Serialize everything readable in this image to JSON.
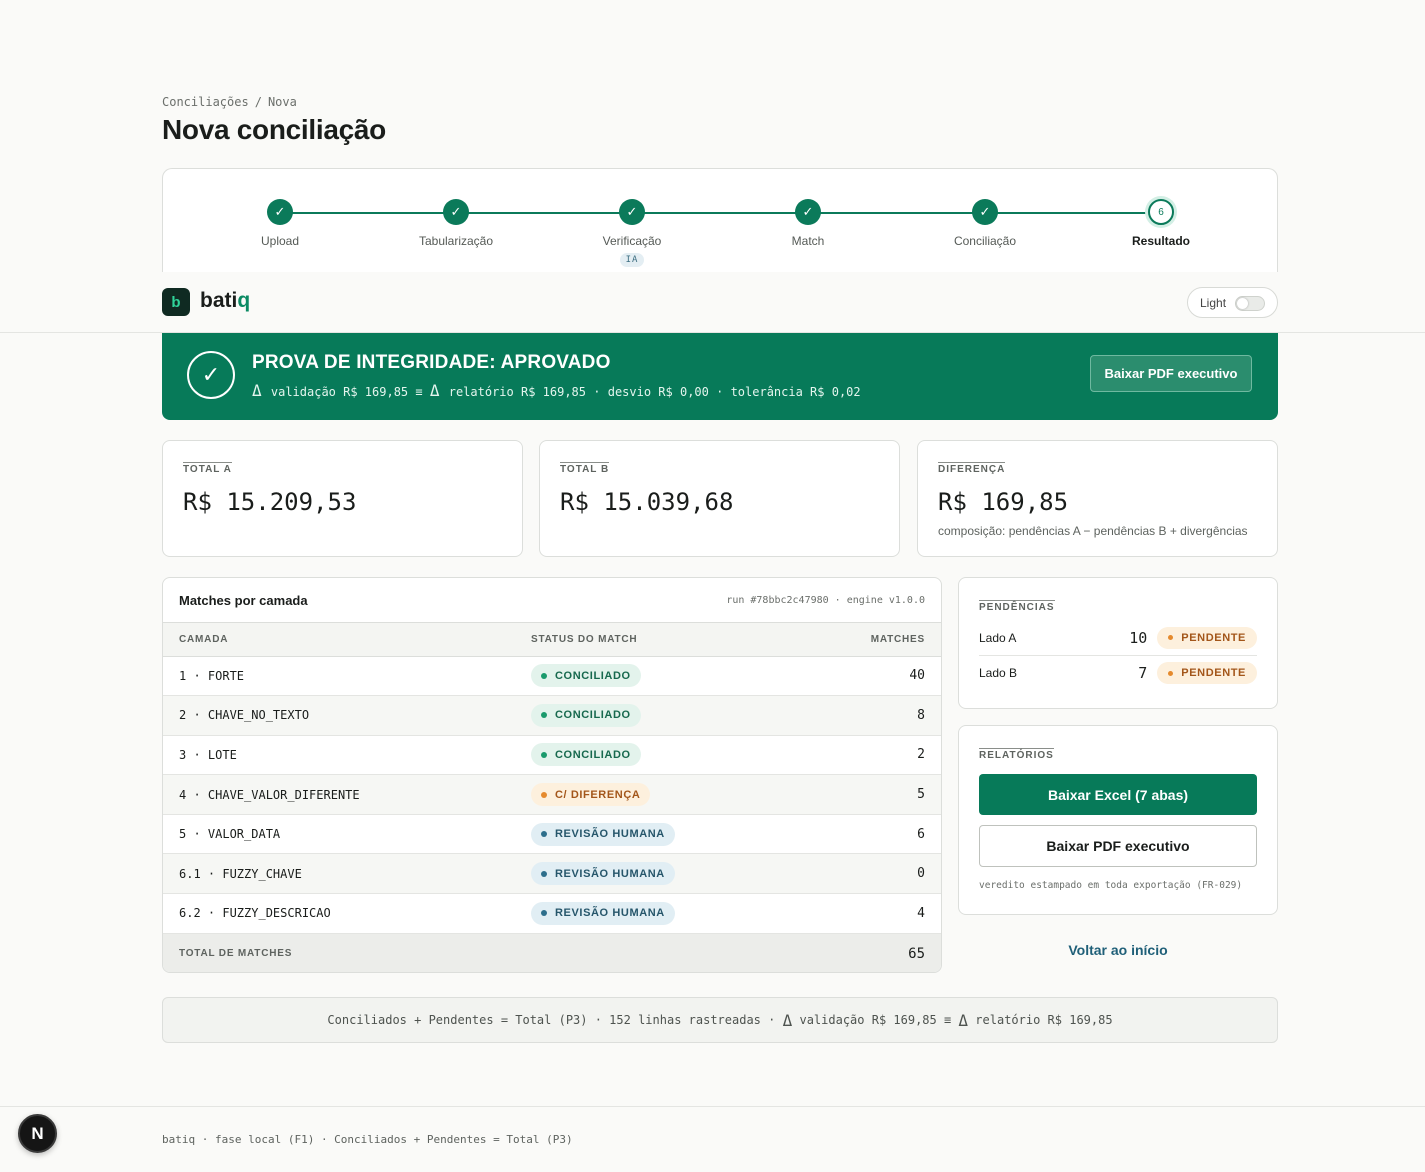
{
  "breadcrumb": {
    "parent": "Conciliações",
    "separator": "/",
    "current": "Nova"
  },
  "page_title": "Nova conciliação",
  "stepper": {
    "steps": [
      {
        "label": "Upload",
        "state": "done"
      },
      {
        "label": "Tabularização",
        "state": "done"
      },
      {
        "label": "Verificação",
        "state": "done",
        "badge": "IA"
      },
      {
        "label": "Match",
        "state": "done"
      },
      {
        "label": "Conciliação",
        "state": "done"
      },
      {
        "label": "Resultado",
        "state": "current",
        "number": "6"
      }
    ]
  },
  "navbar": {
    "logo_letter": "b",
    "brand_main": "bati",
    "brand_accent": "q",
    "theme_label": "Light"
  },
  "banner": {
    "title": "PROVA DE INTEGRIDADE: APROVADO",
    "delta": "Δ",
    "validation": "validação R$ 169,85",
    "equiv": "≡",
    "report": "relatório R$ 169,85",
    "deviation": "desvio R$ 0,00",
    "tolerance": "tolerância R$ 0,02",
    "dot": "·",
    "button": "Baixar PDF executivo"
  },
  "stats": {
    "total_a": {
      "label": "TOTAL A",
      "value": "R$ 15.209,53"
    },
    "total_b": {
      "label": "TOTAL B",
      "value": "R$ 15.039,68"
    },
    "diff": {
      "label": "DIFERENÇA",
      "value": "R$ 169,85",
      "note": "composição: pendências A − pendências B + divergências"
    }
  },
  "matches": {
    "title": "Matches por camada",
    "meta": "run #78bbc2c47980 · engine v1.0.0",
    "columns": [
      "CAMADA",
      "STATUS DO MATCH",
      "MATCHES"
    ],
    "rows": [
      {
        "layer": "1 · FORTE",
        "status": "CONCILIADO",
        "tone": "green",
        "count": "40"
      },
      {
        "layer": "2 · CHAVE_NO_TEXTO",
        "status": "CONCILIADO",
        "tone": "green",
        "count": "8"
      },
      {
        "layer": "3 · LOTE",
        "status": "CONCILIADO",
        "tone": "green",
        "count": "2"
      },
      {
        "layer": "4 · CHAVE_VALOR_DIFERENTE",
        "status": "C/ DIFERENÇA",
        "tone": "orange",
        "count": "5"
      },
      {
        "layer": "5 · VALOR_DATA",
        "status": "REVISÃO HUMANA",
        "tone": "blue",
        "count": "6"
      },
      {
        "layer": "6.1 · FUZZY_CHAVE",
        "status": "REVISÃO HUMANA",
        "tone": "blue",
        "count": "0"
      },
      {
        "layer": "6.2 · FUZZY_DESCRICAO",
        "status": "REVISÃO HUMANA",
        "tone": "blue",
        "count": "4"
      }
    ],
    "total_label": "TOTAL DE MATCHES",
    "total_value": "65"
  },
  "pendencias": {
    "title": "PENDÊNCIAS",
    "rows": [
      {
        "label": "Lado A",
        "count": "10",
        "status": "PENDENTE"
      },
      {
        "label": "Lado B",
        "count": "7",
        "status": "PENDENTE"
      }
    ]
  },
  "relatorios": {
    "title": "RELATÓRIOS",
    "excel_button": "Baixar Excel (7 abas)",
    "pdf_button": "Baixar PDF executivo",
    "note": "veredito estampado em toda exportação (FR-029)"
  },
  "back_link": "Voltar ao início",
  "invariant": {
    "part1": "Conciliados + Pendentes = Total (P3) · 152 linhas rastreadas ·",
    "delta": "Δ",
    "part2": "validação R$ 169,85 ≡",
    "part3": "relatório R$ 169,85"
  },
  "footer": "batiq · fase local (F1) · Conciliados + Pendentes = Total (P3)",
  "dev_badge": "N",
  "colors": {
    "brand": "#077a59",
    "accent": "#0b8a63",
    "warning": "#e58a2d",
    "info": "#2d6f8c"
  }
}
